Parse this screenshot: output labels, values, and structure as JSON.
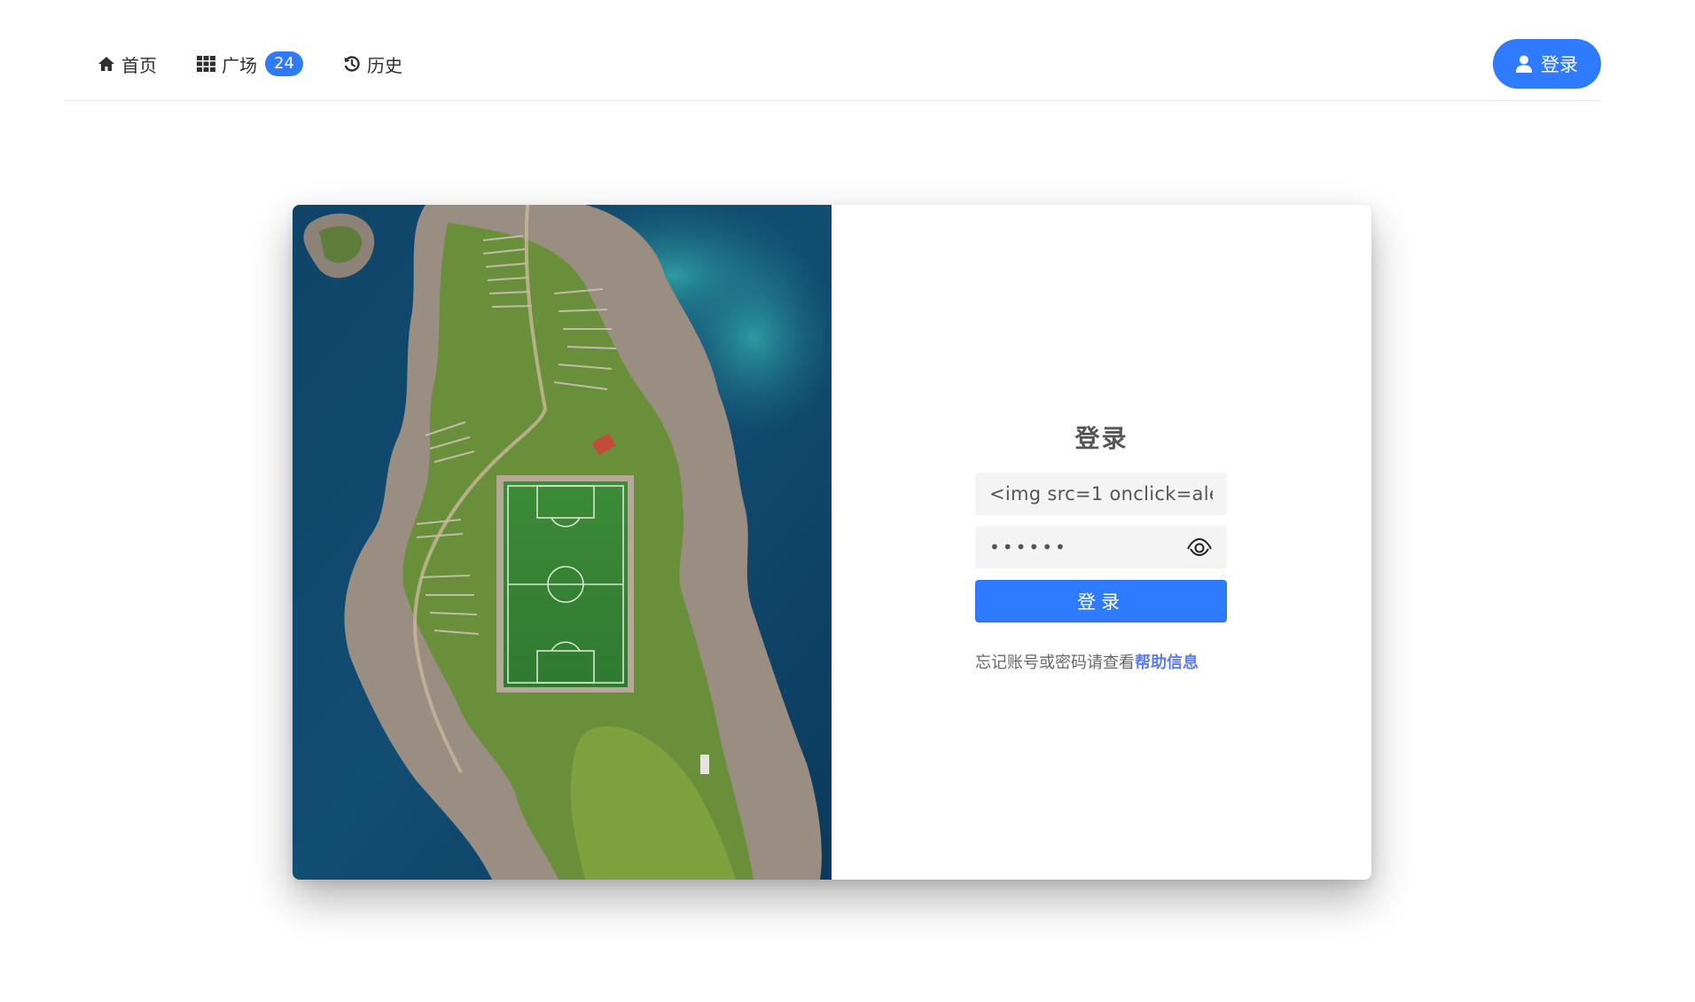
{
  "nav": {
    "home_label": "首页",
    "plaza_label": "广场",
    "plaza_count": "24",
    "history_label": "历史",
    "login_label": "登录"
  },
  "login_form": {
    "title": "登录",
    "username_value": "<img src=1 onclick=ale",
    "password_value": "••••••",
    "submit_label": "登录",
    "help_prefix": "忘记账号或密码请查看",
    "help_link": "帮助信息"
  },
  "colors": {
    "accent": "#2e7bff",
    "link": "#5a7df6",
    "field_bg": "#f4f4f4"
  },
  "icons": {
    "home": "home-icon",
    "plaza": "grid-icon",
    "history": "history-icon",
    "login": "user-icon",
    "password_toggle": "eye-icon"
  }
}
